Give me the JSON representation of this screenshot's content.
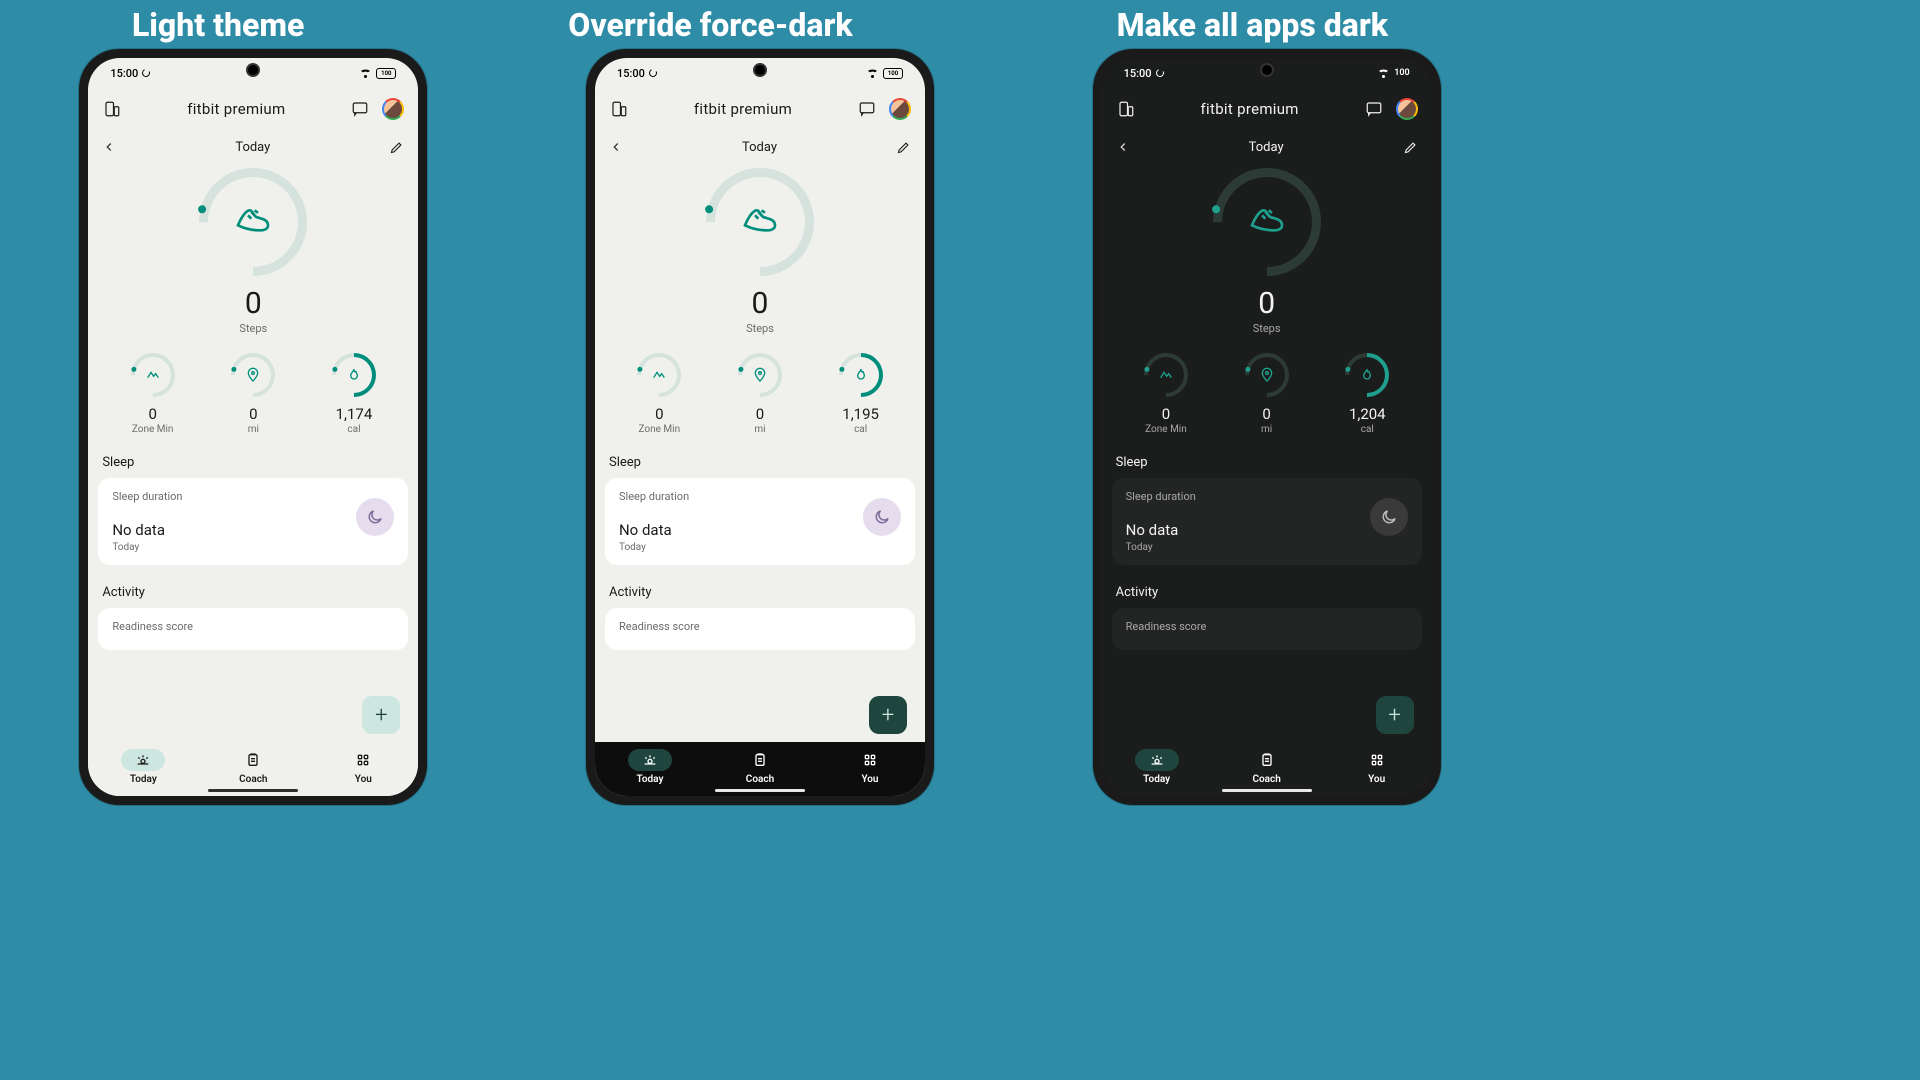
{
  "captions": {
    "light": "Light theme",
    "mid": "Override force-dark",
    "dark": "Make all apps dark"
  },
  "status": {
    "time": "15:00",
    "battery_label": "100",
    "battery_label_dark": "100"
  },
  "header": {
    "title": "fitbit premium"
  },
  "date_row": {
    "label": "Today"
  },
  "main": {
    "steps_value": "0",
    "steps_label": "Steps"
  },
  "metrics": {
    "zone": {
      "value": "0",
      "label": "Zone Min"
    },
    "mi": {
      "value": "0",
      "label": "mi"
    },
    "cal_light": {
      "value": "1,174",
      "label": "cal"
    },
    "cal_mid": {
      "value": "1,195",
      "label": "cal"
    },
    "cal_dark": {
      "value": "1,204",
      "label": "cal"
    }
  },
  "sleep": {
    "section": "Sleep",
    "card_title": "Sleep duration",
    "card_value": "No data",
    "card_sub": "Today"
  },
  "activity": {
    "section": "Activity",
    "card_title": "Readiness score"
  },
  "nav": {
    "today": "Today",
    "coach": "Coach",
    "you": "You"
  },
  "fab": "+"
}
